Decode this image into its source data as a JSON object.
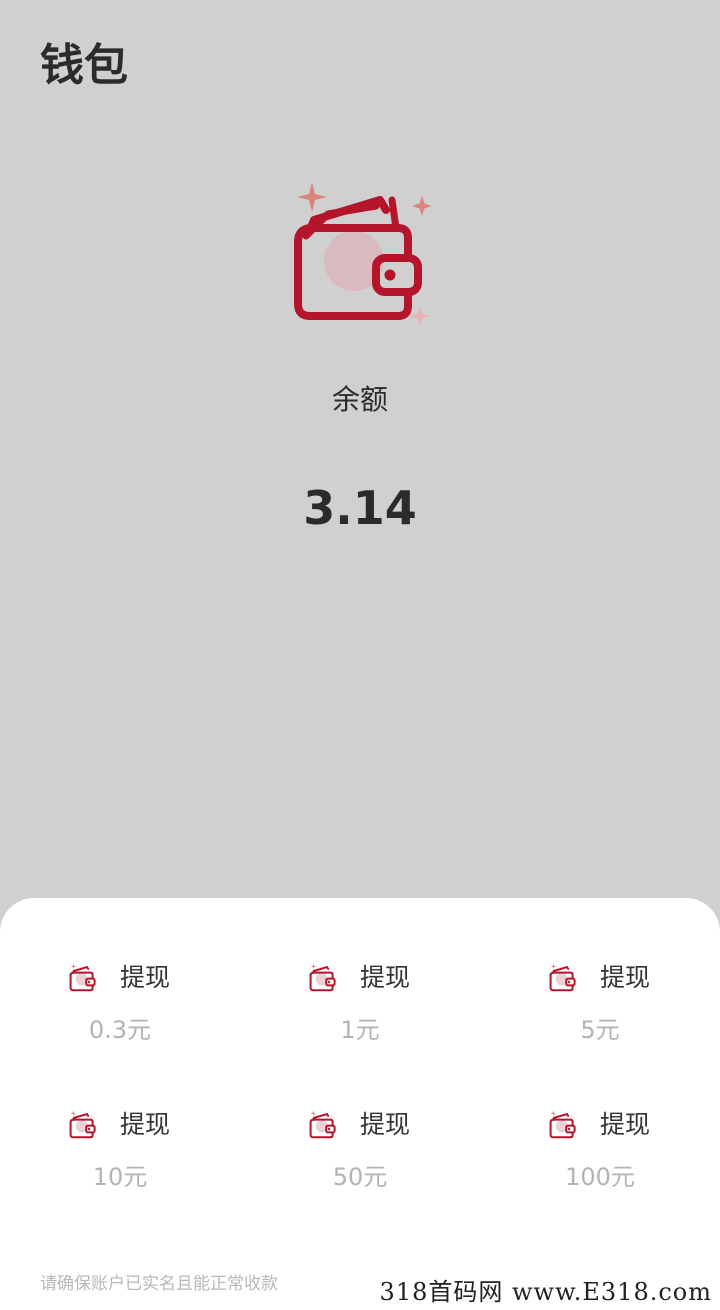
{
  "header": {
    "title": "钱包"
  },
  "balance": {
    "label": "余额",
    "amount": "3.14"
  },
  "withdraw": {
    "options": [
      {
        "label": "提现",
        "amount": "0.3元"
      },
      {
        "label": "提现",
        "amount": "1元"
      },
      {
        "label": "提现",
        "amount": "5元"
      },
      {
        "label": "提现",
        "amount": "10元"
      },
      {
        "label": "提现",
        "amount": "50元"
      },
      {
        "label": "提现",
        "amount": "100元"
      }
    ],
    "notice": "请确保账户已实名且能正常收款"
  },
  "watermark": {
    "text": "318首码网  www.E318.com"
  },
  "icons": {
    "hero": "wallet-icon",
    "option": "wallet-icon"
  },
  "colors": {
    "accent": "#b5152b",
    "sparkle": "#d9837a",
    "background": "#d0d0d0"
  }
}
